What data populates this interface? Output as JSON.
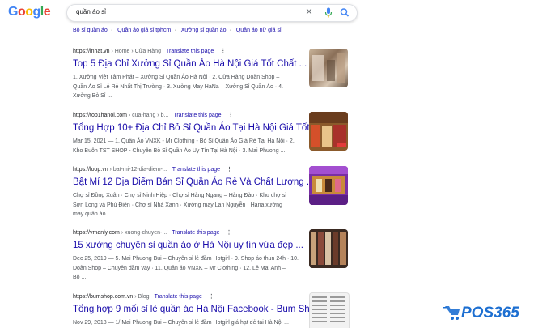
{
  "header": {
    "logo_letters": [
      "G",
      "o",
      "o",
      "g",
      "l",
      "e"
    ],
    "logo_colors": [
      "#4285f4",
      "#ea4335",
      "#fbbc05",
      "#4285f4",
      "#34a853",
      "#ea4335"
    ],
    "query": "quần áo sỉ"
  },
  "related": [
    "Bỏ sỉ quần áo",
    "Quần áo giá sỉ tphcm",
    "Xưởng sỉ quần áo",
    "Quần áo nữ giá sỉ"
  ],
  "results": [
    {
      "domain": "https://inhat.vn",
      "path": " › Home › Cửa Hàng",
      "translate": "Translate this page",
      "title": "Top 5 Địa Chỉ Xưởng Sỉ Quần Áo Hà Nội Giá Tốt Chất ...",
      "lines": [
        "1. Xưởng Việt Tâm Phát – Xưởng Sỉ Quần Áo Hà Nội · 2. Cửa Hàng Doãn Shop –",
        "Quần Áo Sỉ Lẻ Rẻ Nhất Thị Trường · 3. Xưởng May HaNa – Xưởng Sỉ Quần Áo · 4.",
        "Xưởng Bỏ Sỉ ..."
      ]
    },
    {
      "domain": "https://top1hanoi.com",
      "path": " › cua-hang › b...",
      "translate": "Translate this page",
      "title": "Tổng Hợp 10+ Địa Chỉ Bỏ Sỉ Quần Áo Tại Hà Nội Giá Tốt ...",
      "lines": [
        "Mar 15, 2021 — 1. Quần Áo VNXK - Mr Clothing - Bỏ Sỉ Quần Áo Giá Rẻ Tại Hà Nội · 2.",
        "Kho Buôn TST SHOP - Chuyên Bỏ Sỉ Quần Áo Uy Tín Tại Hà Nội · 3. Mai Phuong ..."
      ]
    },
    {
      "domain": "https://loop.vn",
      "path": " › bat-mi-12-dia-diem-...",
      "translate": "Translate this page",
      "title": "Bật Mí 12 Địa Điểm Bán Sỉ Quần Áo Rẻ Và Chất Lượng ...",
      "lines": [
        "Chợ sỉ Đồng Xuân · Chợ sỉ Ninh Hiệp · Chợ sỉ Hàng Ngang – Hàng Đào · Khu chợ sỉ",
        "Sơn Long và Phủ Điền · Chợ sỉ Nhà Xanh · Xưởng may Lan Nguyễn · Hana xưởng",
        "may quần áo ..."
      ]
    },
    {
      "domain": "https://vmanly.com",
      "path": " › xuong-chuyen-...",
      "translate": "Translate this page",
      "title": "15 xưởng chuyên sỉ quần áo ở Hà Nội uy tín vừa đẹp ...",
      "lines": [
        "Dec 25, 2019 — 5. Mai Phuong Bui – Chuyên sỉ lẻ đầm Hotgirl · 9. Shop áo thun 24h · 10.",
        "Doãn Shop – Chuyên đầm váy · 11. Quần áo VNXK – Mr Clothing · 12. Lê Mai Anh –",
        "Bỏ ..."
      ]
    },
    {
      "domain": "https://bumshop.com.vn",
      "path": " › Blog",
      "translate": "Translate this page",
      "title": "Tổng hợp 9 mối sỉ lẻ quần áo Hà Nội Facebook - Bum Shop",
      "lines": [
        "Nov 29, 2018 — 1/ Mai Phuong Bui – Chuyên sỉ lẻ đầm Hotgirl giá hạt dẻ tại Hà Nội ..."
      ]
    }
  ],
  "watermark": {
    "text": "POS365",
    "color": "#1d6fd1"
  }
}
